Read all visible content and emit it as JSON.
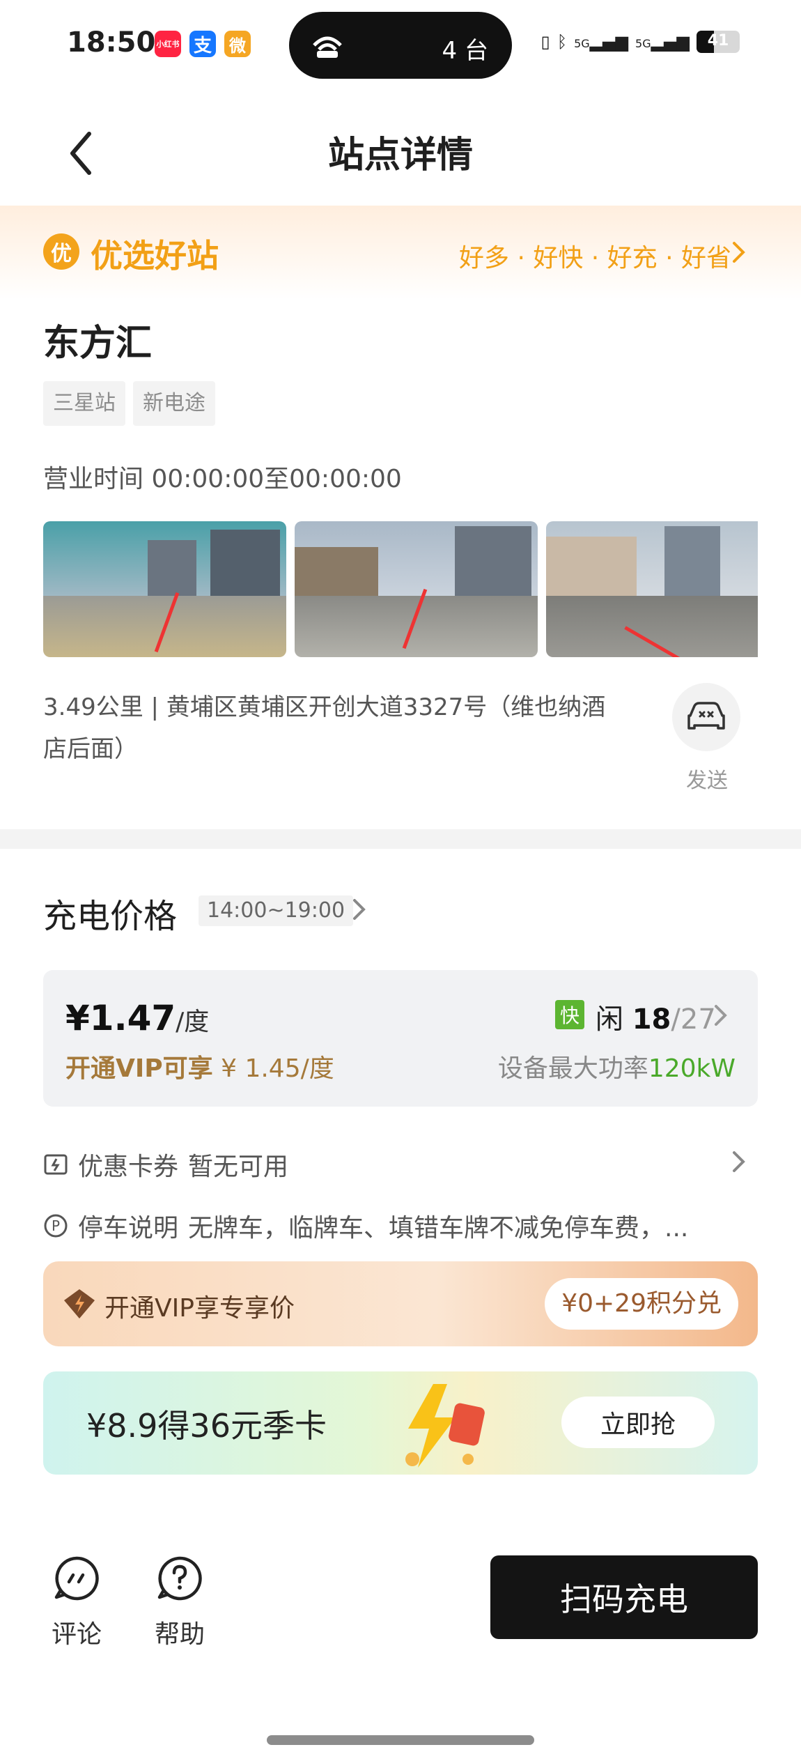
{
  "status_bar": {
    "time": "18:50",
    "notif_icons": [
      {
        "name": "xiaohongshu-icon",
        "text": "小红书",
        "color": "#ff2442"
      },
      {
        "name": "alipay-icon",
        "text": "支",
        "color": "#1677ff"
      },
      {
        "name": "weibo-icon",
        "text": "微",
        "color": "#f5a623"
      }
    ],
    "hotspot_devices": "4 台",
    "signal_labels": [
      "5G",
      "5G"
    ],
    "battery": "41"
  },
  "nav": {
    "title": "站点详情"
  },
  "banner": {
    "badge": "优",
    "title": "优选好站",
    "tags": "好多 · 好快 · 好充 · 好省"
  },
  "station": {
    "name": "东方汇",
    "tags": [
      "三星站",
      "新电途"
    ],
    "hours": "营业时间 00:00:00至00:00:00",
    "address": "3.49公里 | 黄埔区黄埔区开创大道3327号（维也纳酒店后面）",
    "send_label": "发送"
  },
  "price": {
    "section_title": "充电价格",
    "time_range": "14:00~19:00",
    "price": "¥1.47",
    "unit": "/度",
    "vip_label": "开通VIP可享",
    "vip_price": "¥ 1.45/度",
    "fast_badge": "快",
    "idle_label": "闲",
    "idle_count": "18",
    "total_count": "/27",
    "power_label": "设备最大功率",
    "power_value": "120kW"
  },
  "coupons": {
    "label": "优惠卡券",
    "value": "暂无可用"
  },
  "parking": {
    "label": "停车说明",
    "value": "无牌车，临牌车、填错车牌不减免停车费，..."
  },
  "vip_bar": {
    "text": "开通VIP享专享价",
    "pill": "¥0+29积分兑"
  },
  "promo": {
    "text": "¥8.9得36元季卡",
    "button": "立即抢"
  },
  "bottom": {
    "comment_label": "评论",
    "help_label": "帮助",
    "scan_button": "扫码充电"
  },
  "colors": {
    "accent_orange": "#f2a016",
    "vip_brown": "#a5793a",
    "green": "#4aa92a",
    "dark_button": "#141414"
  }
}
